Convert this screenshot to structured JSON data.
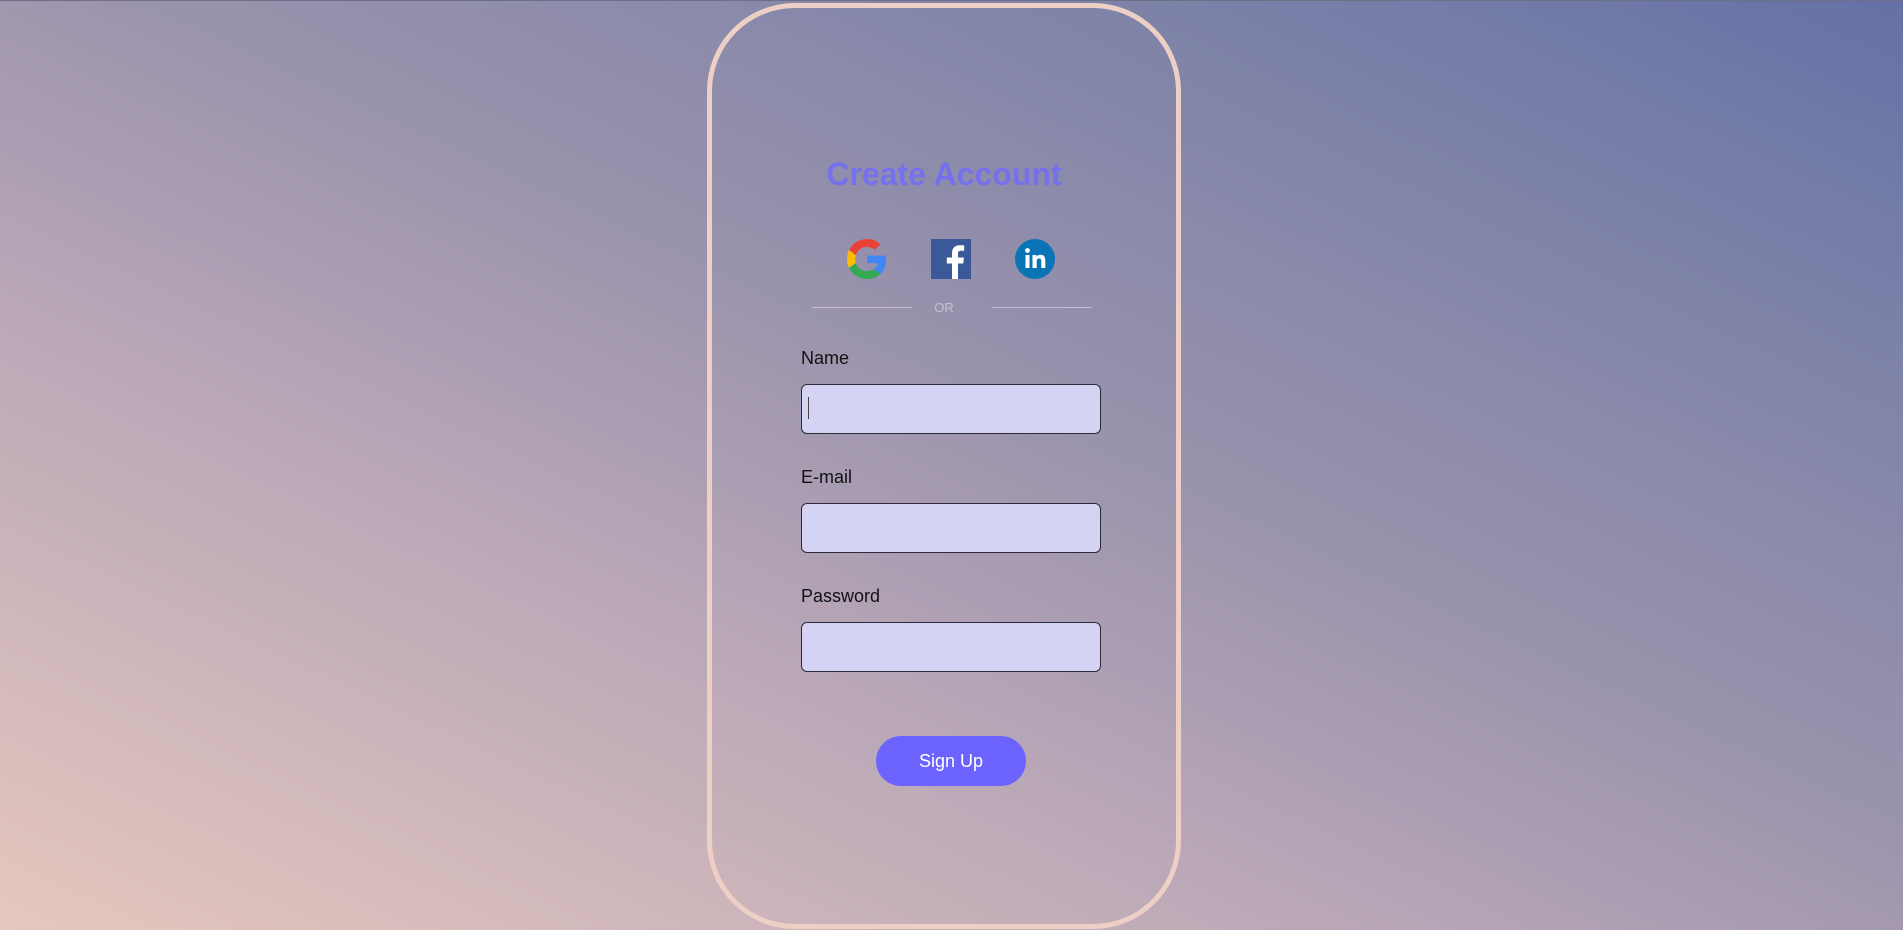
{
  "form": {
    "title": "Create Account",
    "divider_text": "OR",
    "socials": [
      {
        "name": "google-icon"
      },
      {
        "name": "facebook-icon"
      },
      {
        "name": "linkedin-icon"
      }
    ],
    "fields": {
      "name": {
        "label": "Name",
        "value": ""
      },
      "email": {
        "label": "E-mail",
        "value": ""
      },
      "password": {
        "label": "Password",
        "value": ""
      }
    },
    "submit_label": "Sign Up"
  },
  "colors": {
    "accent": "#6c63ff",
    "title": "#7571ed",
    "card_border": "#edcfc5",
    "input_bg": "#d4d3f3"
  }
}
